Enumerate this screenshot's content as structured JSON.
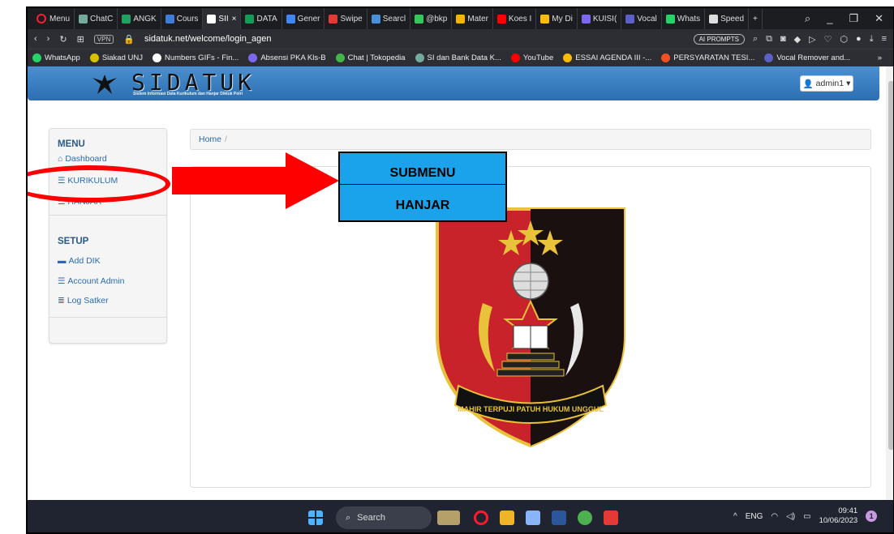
{
  "browser": {
    "menu_label": "Menu",
    "tabs": [
      {
        "label": "ChatC",
        "color": "#74aa9c"
      },
      {
        "label": "ANGK",
        "color": "#1da462"
      },
      {
        "label": "Cours",
        "color": "#3c7dd9"
      },
      {
        "label": "SII",
        "color": "#ffffff",
        "active": true
      },
      {
        "label": "DATA",
        "color": "#0f9d58"
      },
      {
        "label": "Gener",
        "color": "#4285f4"
      },
      {
        "label": "Swipe",
        "color": "#e53935"
      },
      {
        "label": "Searcl",
        "color": "#4a90d9"
      },
      {
        "label": "@bkp",
        "color": "#34c759"
      },
      {
        "label": "Mater",
        "color": "#f4b400"
      },
      {
        "label": "Koes I",
        "color": "#ff0000"
      },
      {
        "label": "My Di",
        "color": "#fbbc04"
      },
      {
        "label": "KUISI(",
        "color": "#7b68ee"
      },
      {
        "label": "Vocal",
        "color": "#5b5fc7"
      },
      {
        "label": "Whats",
        "color": "#25d366"
      },
      {
        "label": "Speed",
        "color": "#dddddd"
      }
    ],
    "tab_close": "×",
    "new_tab": "+",
    "vpn_label": "VPN",
    "url": "sidatuk.net/welcome/login_agen",
    "ai_prompts": "AI PROMPTS",
    "bookmarks": [
      {
        "label": "WhatsApp",
        "color": "#25d366"
      },
      {
        "label": "Siakad UNJ",
        "color": "#d8c200"
      },
      {
        "label": "Numbers GIFs - Fin...",
        "color": "#ffffff"
      },
      {
        "label": "Absensi PKA Kls-B",
        "color": "#7b68ee"
      },
      {
        "label": "Chat | Tokopedia",
        "color": "#42b549"
      },
      {
        "label": "SI dan Bank Data K...",
        "color": "#74aa9c"
      },
      {
        "label": "YouTube",
        "color": "#ff0000"
      },
      {
        "label": "ESSAI AGENDA III -...",
        "color": "#fbbc04"
      },
      {
        "label": "PERSYARATAN TESI...",
        "color": "#f25022"
      },
      {
        "label": "Vocal Remover and...",
        "color": "#5b5fc7"
      }
    ],
    "bookmarks_more": "»"
  },
  "site": {
    "logo_text": "SIDATUK",
    "logo_sub": "Sistem Informasi Data Kurikulum dan Hanjar Diktuk Polri",
    "user": "admin1",
    "sidebar": {
      "menu_heading": "MENU",
      "menu_items": [
        "Dashboard",
        "KURIKULUM",
        "HANJAR"
      ],
      "setup_heading": "SETUP",
      "setup_items": [
        "Add DIK",
        "Account Admin",
        "Log Satker"
      ]
    },
    "breadcrumb": {
      "home": "Home",
      "sep": "/"
    },
    "emblem_motto": "MAHIR TERPUJI PATUH HUKUM UNGGUL"
  },
  "annotation": {
    "callout_line1": "SUBMENU",
    "callout_line2": "HANJAR",
    "color": "#ff0000",
    "callout_bg": "#1aa3ea"
  },
  "taskbar": {
    "search_label": "Search",
    "lang": "ENG",
    "time": "09:41",
    "date": "10/06/2023",
    "notifications": "1"
  }
}
